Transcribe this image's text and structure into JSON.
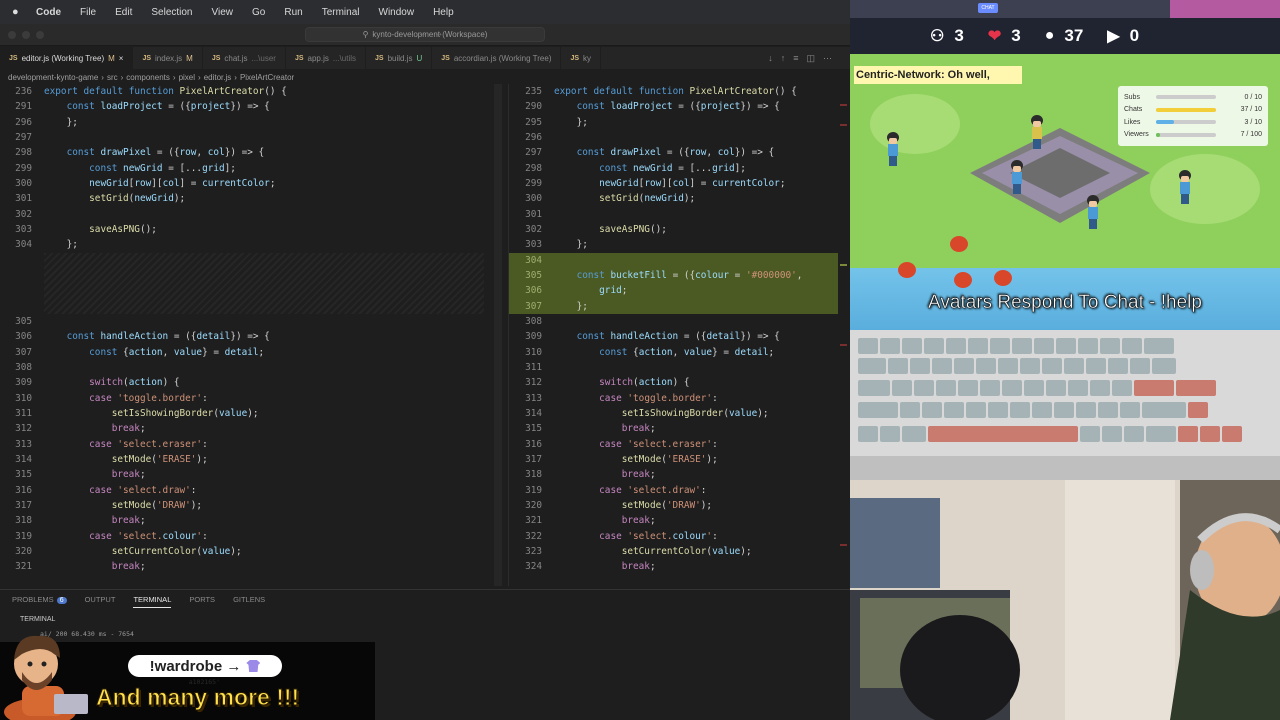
{
  "menubar": {
    "app": "Code",
    "items": [
      "File",
      "Edit",
      "Selection",
      "View",
      "Go",
      "Run",
      "Terminal",
      "Window",
      "Help"
    ]
  },
  "titlebar": {
    "search": "kynto-development (Workspace)"
  },
  "tabs": [
    {
      "label": "editor.js (Working Tree)",
      "status": "M",
      "active": true
    },
    {
      "label": "index.js",
      "status": "M",
      "active": false
    },
    {
      "label": "chat.js",
      "sub": "...\\user",
      "active": false
    },
    {
      "label": "app.js",
      "sub": "...\\utils",
      "active": false
    },
    {
      "label": "build.js",
      "status": "U",
      "active": false
    },
    {
      "label": "accordian.js (Working Tree)",
      "active": false
    },
    {
      "label": "ky",
      "active": false
    }
  ],
  "breadcrumb": [
    "development-kynto-game",
    "src",
    "components",
    "pixel",
    "editor.js",
    "PixelArtCreator"
  ],
  "left_editor": {
    "lines": [
      {
        "n": "236",
        "code": "export default function PixelArtCreator() {"
      },
      {
        "n": "291",
        "code": "    const loadProject = ({project}) => {"
      },
      {
        "n": "296",
        "code": "    };"
      },
      {
        "n": "297",
        "code": ""
      },
      {
        "n": "298",
        "code": "    const drawPixel = ({row, col}) => {"
      },
      {
        "n": "299",
        "code": "        const newGrid = [...grid];"
      },
      {
        "n": "300",
        "code": "        newGrid[row][col] = currentColor;"
      },
      {
        "n": "301",
        "code": "        setGrid(newGrid);"
      },
      {
        "n": "302",
        "code": ""
      },
      {
        "n": "303",
        "code": "        saveAsPNG();"
      },
      {
        "n": "304",
        "code": "    };"
      },
      {
        "n": "",
        "code": ""
      },
      {
        "n": "",
        "code": ""
      },
      {
        "n": "",
        "code": ""
      },
      {
        "n": "",
        "code": ""
      },
      {
        "n": "305",
        "code": ""
      },
      {
        "n": "306",
        "code": "    const handleAction = ({detail}) => {"
      },
      {
        "n": "307",
        "code": "        const {action, value} = detail;"
      },
      {
        "n": "308",
        "code": ""
      },
      {
        "n": "309",
        "code": "        switch(action) {"
      },
      {
        "n": "310",
        "code": "        case 'toggle.border':"
      },
      {
        "n": "311",
        "code": "            setIsShowingBorder(value);"
      },
      {
        "n": "312",
        "code": "            break;"
      },
      {
        "n": "313",
        "code": "        case 'select.eraser':"
      },
      {
        "n": "314",
        "code": "            setMode('ERASE');"
      },
      {
        "n": "315",
        "code": "            break;"
      },
      {
        "n": "316",
        "code": "        case 'select.draw':"
      },
      {
        "n": "317",
        "code": "            setMode('DRAW');"
      },
      {
        "n": "318",
        "code": "            break;"
      },
      {
        "n": "319",
        "code": "        case 'select.colour':"
      },
      {
        "n": "320",
        "code": "            setCurrentColor(value);"
      },
      {
        "n": "321",
        "code": "            break;"
      }
    ]
  },
  "right_editor": {
    "lines": [
      {
        "n": "235",
        "code": "export default function PixelArtCreator() {"
      },
      {
        "n": "290",
        "code": "    const loadProject = ({project}) => {"
      },
      {
        "n": "295",
        "code": "    };"
      },
      {
        "n": "296",
        "code": ""
      },
      {
        "n": "297",
        "code": "    const drawPixel = ({row, col}) => {"
      },
      {
        "n": "298",
        "code": "        const newGrid = [...grid];"
      },
      {
        "n": "299",
        "code": "        newGrid[row][col] = currentColor;"
      },
      {
        "n": "300",
        "code": "        setGrid(newGrid);"
      },
      {
        "n": "301",
        "code": ""
      },
      {
        "n": "302",
        "code": "        saveAsPNG();"
      },
      {
        "n": "303",
        "code": "    };"
      },
      {
        "n": "304",
        "code": "",
        "added": true
      },
      {
        "n": "305",
        "code": "    const bucketFill = ({colour = '#000000',",
        "added": true
      },
      {
        "n": "306",
        "code": "        grid;",
        "added": true
      },
      {
        "n": "307",
        "code": "    };",
        "added": true
      },
      {
        "n": "308",
        "code": ""
      },
      {
        "n": "309",
        "code": "    const handleAction = ({detail}) => {"
      },
      {
        "n": "310",
        "code": "        const {action, value} = detail;"
      },
      {
        "n": "311",
        "code": ""
      },
      {
        "n": "312",
        "code": "        switch(action) {"
      },
      {
        "n": "313",
        "code": "        case 'toggle.border':"
      },
      {
        "n": "314",
        "code": "            setIsShowingBorder(value);"
      },
      {
        "n": "315",
        "code": "            break;"
      },
      {
        "n": "316",
        "code": "        case 'select.eraser':"
      },
      {
        "n": "317",
        "code": "            setMode('ERASE');"
      },
      {
        "n": "318",
        "code": "            break;"
      },
      {
        "n": "319",
        "code": "        case 'select.draw':"
      },
      {
        "n": "320",
        "code": "            setMode('DRAW');"
      },
      {
        "n": "321",
        "code": "            break;"
      },
      {
        "n": "322",
        "code": "        case 'select.colour':"
      },
      {
        "n": "323",
        "code": "            setCurrentColor(value);"
      },
      {
        "n": "324",
        "code": "            break;"
      }
    ]
  },
  "panel": {
    "tabs": [
      {
        "label": "PROBLEMS",
        "badge": "6"
      },
      {
        "label": "OUTPUT"
      },
      {
        "label": "TERMINAL",
        "active": true
      },
      {
        "label": "PORTS"
      },
      {
        "label": "GITLENS"
      }
    ],
    "terminal_label": "TERMINAL",
    "terminal_text": "ai/ 200 68.430 ms - 7654\n                                                         \n                                                         \n                                                         \n                                      ,999 ms - 36\n                                      a102165'\n                                      a102165'"
  },
  "overlay": {
    "wardrobe": "!wardrobe →",
    "many_more": "And many more !!!"
  },
  "game": {
    "chat_pill": "CHAT",
    "stats": [
      {
        "icon": "users-icon",
        "value": "3"
      },
      {
        "icon": "heart-icon",
        "value": "3"
      },
      {
        "icon": "chat-bubble-icon",
        "value": "37"
      },
      {
        "icon": "camera-icon",
        "value": "0"
      }
    ],
    "chat_message": "Centric-Network: Oh well,",
    "goals": [
      {
        "label": "Subs",
        "value": "0 / 10",
        "fill": 0.0,
        "color": "#f2a33a"
      },
      {
        "label": "Chats",
        "value": "37 / 10",
        "fill": 1.0,
        "color": "#f2cf3a"
      },
      {
        "label": "Likes",
        "value": "3 / 10",
        "fill": 0.3,
        "color": "#5fb0e6"
      },
      {
        "label": "Viewers",
        "value": "7 / 100",
        "fill": 0.07,
        "color": "#6fbf5a"
      }
    ],
    "help": "Avatars Respond To Chat - !help"
  },
  "colors": {
    "added_line": "#4b5a23",
    "accent": "#4d78cc",
    "overlay_yellow": "#ffe14d"
  }
}
